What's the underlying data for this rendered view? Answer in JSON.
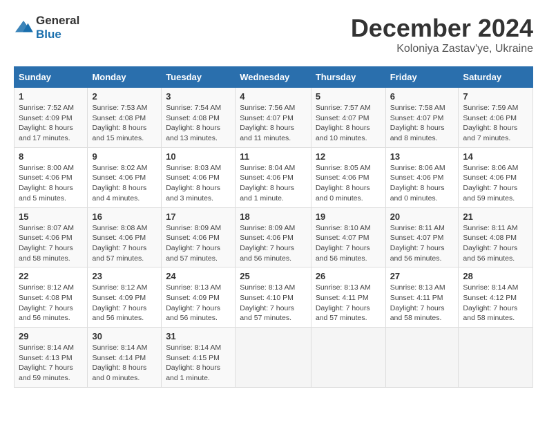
{
  "header": {
    "logo_general": "General",
    "logo_blue": "Blue",
    "month_title": "December 2024",
    "location": "Koloniya Zastav'ye, Ukraine"
  },
  "weekdays": [
    "Sunday",
    "Monday",
    "Tuesday",
    "Wednesday",
    "Thursday",
    "Friday",
    "Saturday"
  ],
  "weeks": [
    [
      {
        "day": "1",
        "detail": "Sunrise: 7:52 AM\nSunset: 4:09 PM\nDaylight: 8 hours and 17 minutes."
      },
      {
        "day": "2",
        "detail": "Sunrise: 7:53 AM\nSunset: 4:08 PM\nDaylight: 8 hours and 15 minutes."
      },
      {
        "day": "3",
        "detail": "Sunrise: 7:54 AM\nSunset: 4:08 PM\nDaylight: 8 hours and 13 minutes."
      },
      {
        "day": "4",
        "detail": "Sunrise: 7:56 AM\nSunset: 4:07 PM\nDaylight: 8 hours and 11 minutes."
      },
      {
        "day": "5",
        "detail": "Sunrise: 7:57 AM\nSunset: 4:07 PM\nDaylight: 8 hours and 10 minutes."
      },
      {
        "day": "6",
        "detail": "Sunrise: 7:58 AM\nSunset: 4:07 PM\nDaylight: 8 hours and 8 minutes."
      },
      {
        "day": "7",
        "detail": "Sunrise: 7:59 AM\nSunset: 4:06 PM\nDaylight: 8 hours and 7 minutes."
      }
    ],
    [
      {
        "day": "8",
        "detail": "Sunrise: 8:00 AM\nSunset: 4:06 PM\nDaylight: 8 hours and 5 minutes."
      },
      {
        "day": "9",
        "detail": "Sunrise: 8:02 AM\nSunset: 4:06 PM\nDaylight: 8 hours and 4 minutes."
      },
      {
        "day": "10",
        "detail": "Sunrise: 8:03 AM\nSunset: 4:06 PM\nDaylight: 8 hours and 3 minutes."
      },
      {
        "day": "11",
        "detail": "Sunrise: 8:04 AM\nSunset: 4:06 PM\nDaylight: 8 hours and 1 minute."
      },
      {
        "day": "12",
        "detail": "Sunrise: 8:05 AM\nSunset: 4:06 PM\nDaylight: 8 hours and 0 minutes."
      },
      {
        "day": "13",
        "detail": "Sunrise: 8:06 AM\nSunset: 4:06 PM\nDaylight: 8 hours and 0 minutes."
      },
      {
        "day": "14",
        "detail": "Sunrise: 8:06 AM\nSunset: 4:06 PM\nDaylight: 7 hours and 59 minutes."
      }
    ],
    [
      {
        "day": "15",
        "detail": "Sunrise: 8:07 AM\nSunset: 4:06 PM\nDaylight: 7 hours and 58 minutes."
      },
      {
        "day": "16",
        "detail": "Sunrise: 8:08 AM\nSunset: 4:06 PM\nDaylight: 7 hours and 57 minutes."
      },
      {
        "day": "17",
        "detail": "Sunrise: 8:09 AM\nSunset: 4:06 PM\nDaylight: 7 hours and 57 minutes."
      },
      {
        "day": "18",
        "detail": "Sunrise: 8:09 AM\nSunset: 4:06 PM\nDaylight: 7 hours and 56 minutes."
      },
      {
        "day": "19",
        "detail": "Sunrise: 8:10 AM\nSunset: 4:07 PM\nDaylight: 7 hours and 56 minutes."
      },
      {
        "day": "20",
        "detail": "Sunrise: 8:11 AM\nSunset: 4:07 PM\nDaylight: 7 hours and 56 minutes."
      },
      {
        "day": "21",
        "detail": "Sunrise: 8:11 AM\nSunset: 4:08 PM\nDaylight: 7 hours and 56 minutes."
      }
    ],
    [
      {
        "day": "22",
        "detail": "Sunrise: 8:12 AM\nSunset: 4:08 PM\nDaylight: 7 hours and 56 minutes."
      },
      {
        "day": "23",
        "detail": "Sunrise: 8:12 AM\nSunset: 4:09 PM\nDaylight: 7 hours and 56 minutes."
      },
      {
        "day": "24",
        "detail": "Sunrise: 8:13 AM\nSunset: 4:09 PM\nDaylight: 7 hours and 56 minutes."
      },
      {
        "day": "25",
        "detail": "Sunrise: 8:13 AM\nSunset: 4:10 PM\nDaylight: 7 hours and 57 minutes."
      },
      {
        "day": "26",
        "detail": "Sunrise: 8:13 AM\nSunset: 4:11 PM\nDaylight: 7 hours and 57 minutes."
      },
      {
        "day": "27",
        "detail": "Sunrise: 8:13 AM\nSunset: 4:11 PM\nDaylight: 7 hours and 58 minutes."
      },
      {
        "day": "28",
        "detail": "Sunrise: 8:14 AM\nSunset: 4:12 PM\nDaylight: 7 hours and 58 minutes."
      }
    ],
    [
      {
        "day": "29",
        "detail": "Sunrise: 8:14 AM\nSunset: 4:13 PM\nDaylight: 7 hours and 59 minutes."
      },
      {
        "day": "30",
        "detail": "Sunrise: 8:14 AM\nSunset: 4:14 PM\nDaylight: 8 hours and 0 minutes."
      },
      {
        "day": "31",
        "detail": "Sunrise: 8:14 AM\nSunset: 4:15 PM\nDaylight: 8 hours and 1 minute."
      },
      null,
      null,
      null,
      null
    ]
  ]
}
